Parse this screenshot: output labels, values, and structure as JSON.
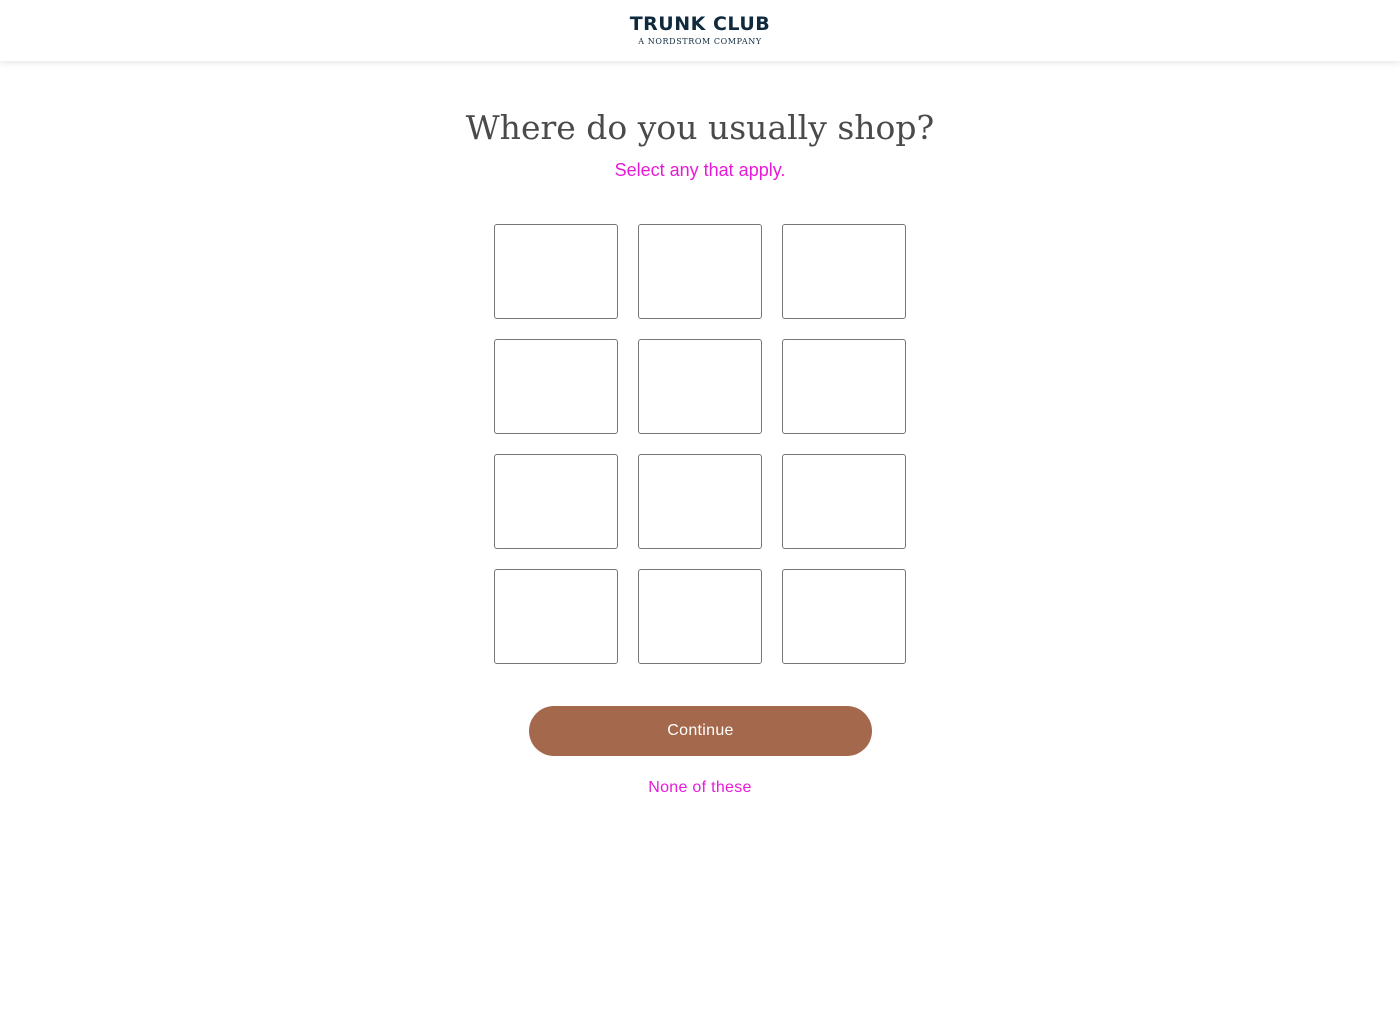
{
  "header": {
    "logo_main": "TRUNK CLUB",
    "logo_sub": "A NORDSTROM COMPANY"
  },
  "main": {
    "title": "Where do you usually shop?",
    "subtitle": "Select any that apply.",
    "options": [
      {
        "label": ""
      },
      {
        "label": ""
      },
      {
        "label": ""
      },
      {
        "label": ""
      },
      {
        "label": ""
      },
      {
        "label": ""
      },
      {
        "label": ""
      },
      {
        "label": ""
      },
      {
        "label": ""
      },
      {
        "label": ""
      },
      {
        "label": ""
      },
      {
        "label": ""
      }
    ],
    "continue_label": "Continue",
    "none_label": "None of these"
  },
  "colors": {
    "accent_pink": "#e81ad9",
    "button_brown": "#a4694c",
    "logo_navy": "#0f2a3d"
  }
}
